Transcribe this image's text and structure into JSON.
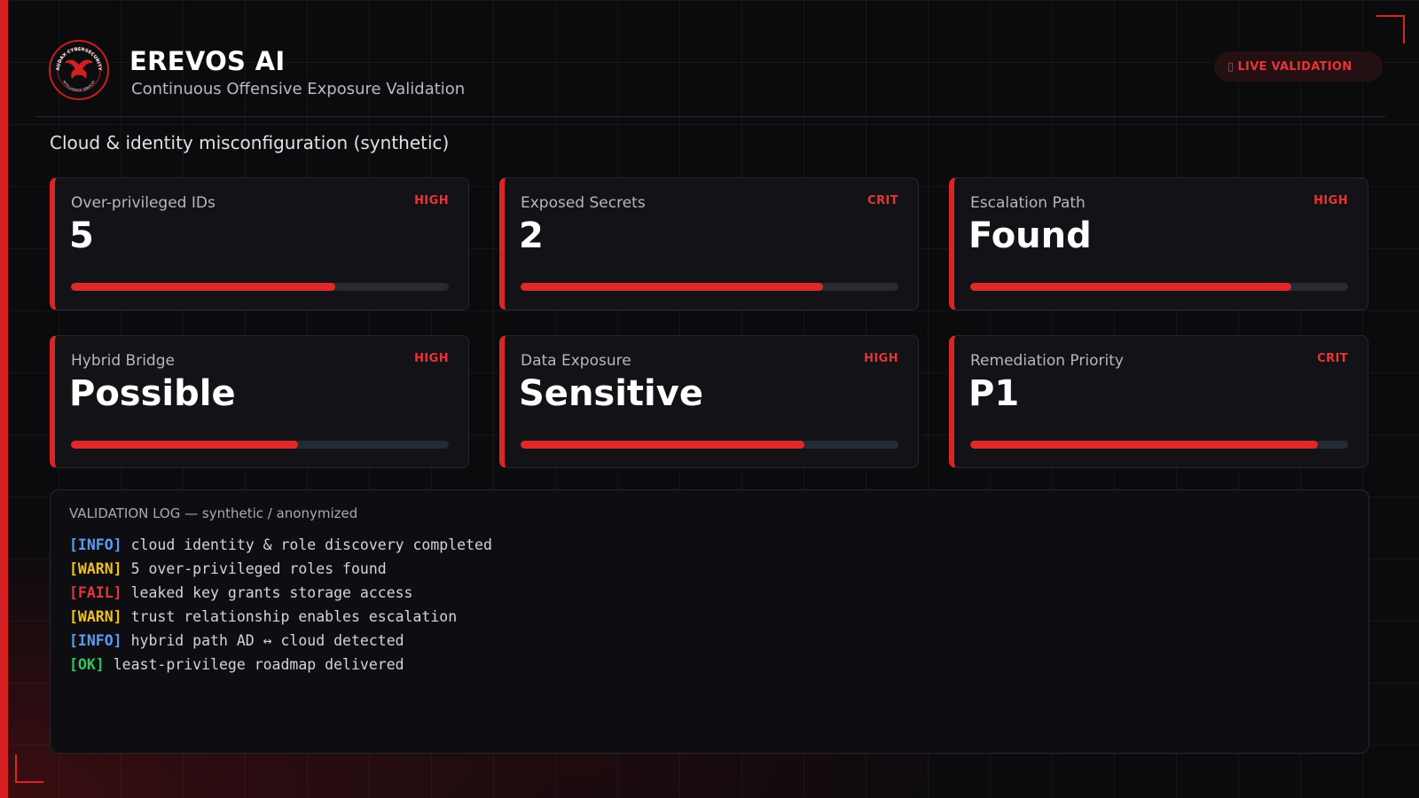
{
  "header": {
    "app_title": "EREVOS AI",
    "subtitle": "Continuous Offensive Exposure Validation",
    "logo_text_top": "AUDAX CYBERSECURITY",
    "logo_text_bottom": "INTELLIGENCE SERVICES",
    "live_badge": {
      "icon": "dot-icon",
      "label": "LIVE VALIDATION"
    }
  },
  "section_title": "Cloud & identity misconfiguration (synthetic)",
  "cards": [
    {
      "label": "Over-privileged IDs",
      "severity": "HIGH",
      "value": "5",
      "progress": 0.7
    },
    {
      "label": "Exposed Secrets",
      "severity": "CRIT",
      "value": "2",
      "progress": 0.8
    },
    {
      "label": "Escalation Path",
      "severity": "HIGH",
      "value": "Found",
      "progress": 0.85
    },
    {
      "label": "Hybrid Bridge",
      "severity": "HIGH",
      "value": "Possible",
      "progress": 0.6
    },
    {
      "label": "Data Exposure",
      "severity": "HIGH",
      "value": "Sensitive",
      "progress": 0.75
    },
    {
      "label": "Remediation Priority",
      "severity": "CRIT",
      "value": "P1",
      "progress": 0.92
    }
  ],
  "log": {
    "title": "VALIDATION LOG — synthetic / anonymized",
    "lines": [
      {
        "tag": "[INFO]",
        "level": "info",
        "text": "cloud identity & role discovery completed"
      },
      {
        "tag": "[WARN]",
        "level": "warn",
        "text": "5 over-privileged roles found"
      },
      {
        "tag": "[FAIL]",
        "level": "fail",
        "text": "leaked key grants storage access"
      },
      {
        "tag": "[WARN]",
        "level": "warn",
        "text": "trust relationship enables escalation"
      },
      {
        "tag": "[INFO]",
        "level": "info",
        "text": "hybrid path AD ↔ cloud detected"
      },
      {
        "tag": "[OK]",
        "level": "ok",
        "text": "least-privilege roadmap delivered"
      }
    ]
  },
  "colors": {
    "accent": "#d82626",
    "info": "#5a9cf5",
    "warn": "#f0c020",
    "fail": "#e53535",
    "ok": "#2fc462"
  }
}
